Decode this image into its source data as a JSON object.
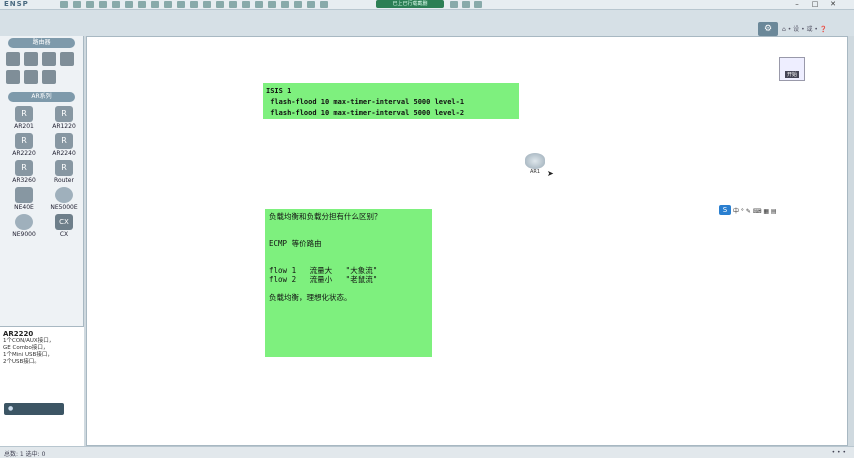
{
  "titlebar": {
    "logo": "ENSP",
    "window_title": "已上已行载截删",
    "controls": [
      "–",
      "□",
      "✕"
    ]
  },
  "hub": {
    "icon": "gear-icon",
    "text": "⌂ • 设 • 或 • ❓"
  },
  "left_panel": {
    "category_header": "路由器",
    "devices_header": "AR系列",
    "devices": [
      {
        "label": "AR201",
        "icon": "R",
        "shape": "square"
      },
      {
        "label": "AR1220",
        "icon": "R",
        "shape": "square"
      },
      {
        "label": "AR2220",
        "icon": "R",
        "shape": "square"
      },
      {
        "label": "AR2240",
        "icon": "R",
        "shape": "square"
      },
      {
        "label": "AR3260",
        "icon": "R",
        "shape": "square"
      },
      {
        "label": "Router",
        "icon": "R",
        "shape": "square"
      },
      {
        "label": "NE40E",
        "icon": "",
        "shape": "square"
      },
      {
        "label": "NE5000E",
        "icon": "",
        "shape": "round"
      },
      {
        "label": "NE9000",
        "icon": "",
        "shape": "round"
      },
      {
        "label": "CX",
        "icon": "CX",
        "shape": "cx"
      }
    ],
    "description": {
      "title": "AR2220",
      "lines": [
        "1个CON/AUX接口，",
        "GE Combo接口，",
        "1个Mini USB接口，",
        "2个USB接口。"
      ],
      "button": "●"
    }
  },
  "canvas": {
    "note1": "ISIS 1\n flash-flood 10 max-timer-interval 5000 level-1\n flash-flood 10 max-timer-interval 5000 level-2",
    "note2": "负载均衡和负载分担有什么区别？\n\n\nECMP 等价路由\n\n\nflow 1   流量大   \"大象流\"\nflow 2   流量小   \"老鼠流\"\n\n负载均衡，理想化状态。",
    "router_label": "AR1",
    "start_button": "开始",
    "ime": {
      "logo": "S",
      "items": "中 ° ✎ ⌨ ▦ ▤"
    }
  },
  "status": {
    "left": "总数: 1  选中: 0",
    "right": "• • •"
  }
}
